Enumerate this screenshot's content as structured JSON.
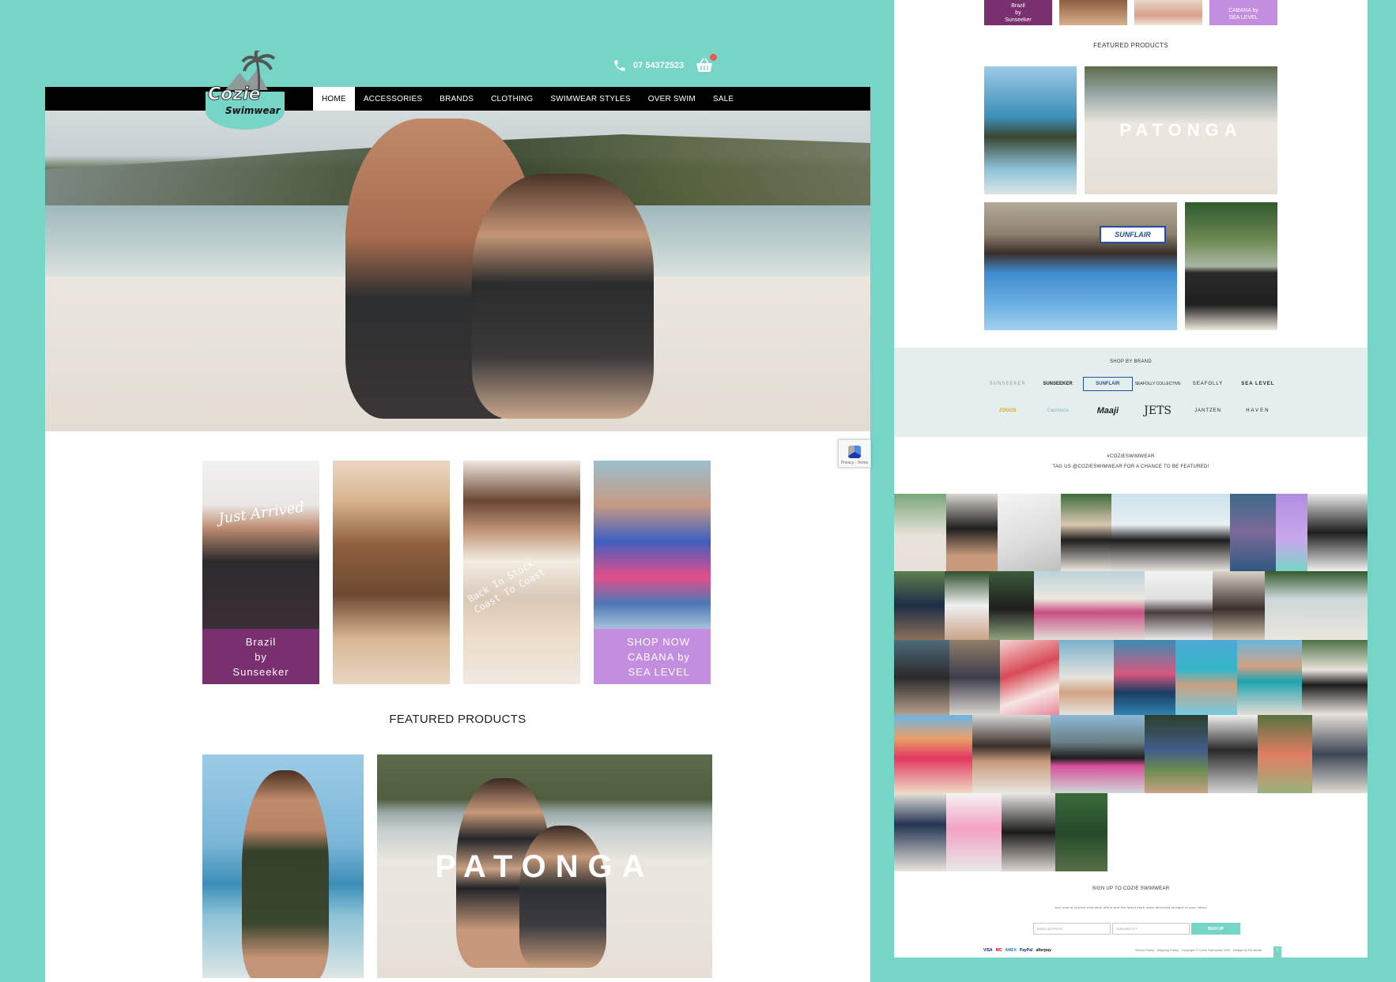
{
  "brand": {
    "logo_top": "Cozie",
    "logo_bottom": "Swimwear",
    "accent": "#76d5c6"
  },
  "header": {
    "phone": "07 54372523",
    "phone_icon": "phone-icon",
    "cart_icon": "basket-icon"
  },
  "nav": {
    "items": [
      "HOME",
      "ACCESSORIES",
      "BRANDS",
      "CLOTHING",
      "SWIMWEAR STYLES",
      "OVER SWIM",
      "SALE"
    ],
    "active": "HOME"
  },
  "promo_tiles": [
    {
      "script": "Just Arrived",
      "caption_lines": [
        "Brazil",
        "by",
        "Sunseeker"
      ],
      "caption_bg": "#7a2f6e"
    },
    {
      "caption_lines": []
    },
    {
      "stamp_lines": [
        "Back In Stock",
        "Coast To Coast"
      ],
      "caption_lines": []
    },
    {
      "caption_lines": [
        "SHOP NOW",
        "CABANA  by",
        "SEA LEVEL"
      ],
      "caption_bg": "#c48ee0"
    }
  ],
  "featured": {
    "title": "FEATURED PRODUCTS",
    "patonga": "PATONGA",
    "sunflair": "SUNFLAIR"
  },
  "thumb": {
    "top_tiles": [
      {
        "lines": [
          "Brazil",
          "by",
          "Sunseeker"
        ]
      },
      {
        "lines": []
      },
      {
        "lines": []
      },
      {
        "lines": [
          "CABANA  by",
          "SEA LEVEL"
        ]
      }
    ],
    "featured_title": "FEATURED PRODUCTS",
    "shop_by_brand": "SHOP BY BRAND",
    "brands": [
      "SUNSEEKER",
      "SUNSEEKER",
      "SUNFLAIR",
      "SEAFOLLY COLLECTIVE",
      "SEAFOLLY",
      "SEA LEVEL",
      "ZOGGS",
      "Capriosca",
      "Maaji",
      "JETS",
      "JANTZEN",
      "HAVEN"
    ],
    "hashtag": "#COZIESWIMWEAR",
    "tag_line": "TAG US @COZIESWIMWEAR FOR A CHANCE TO BE FEATURED!",
    "signup_title": "SIGN UP TO COZIE SWIMWEAR",
    "signup_text": "Join now to receive exclusive offers and the latest style news delivered straight to your inbox!",
    "email_placeholder": "EMAIL ADDRESS",
    "postcode_placeholder": "SUBURB/CITY",
    "signup_button": "SIGN UP",
    "cards": [
      "VISA",
      "MC",
      "AMEX",
      "PayPal",
      "afterpay"
    ],
    "footer_text": "Return Policy · Shipping Policy · Copyright © Cozie Swimwear 2020 · Design by FB Media",
    "scroll_top": "↑"
  }
}
